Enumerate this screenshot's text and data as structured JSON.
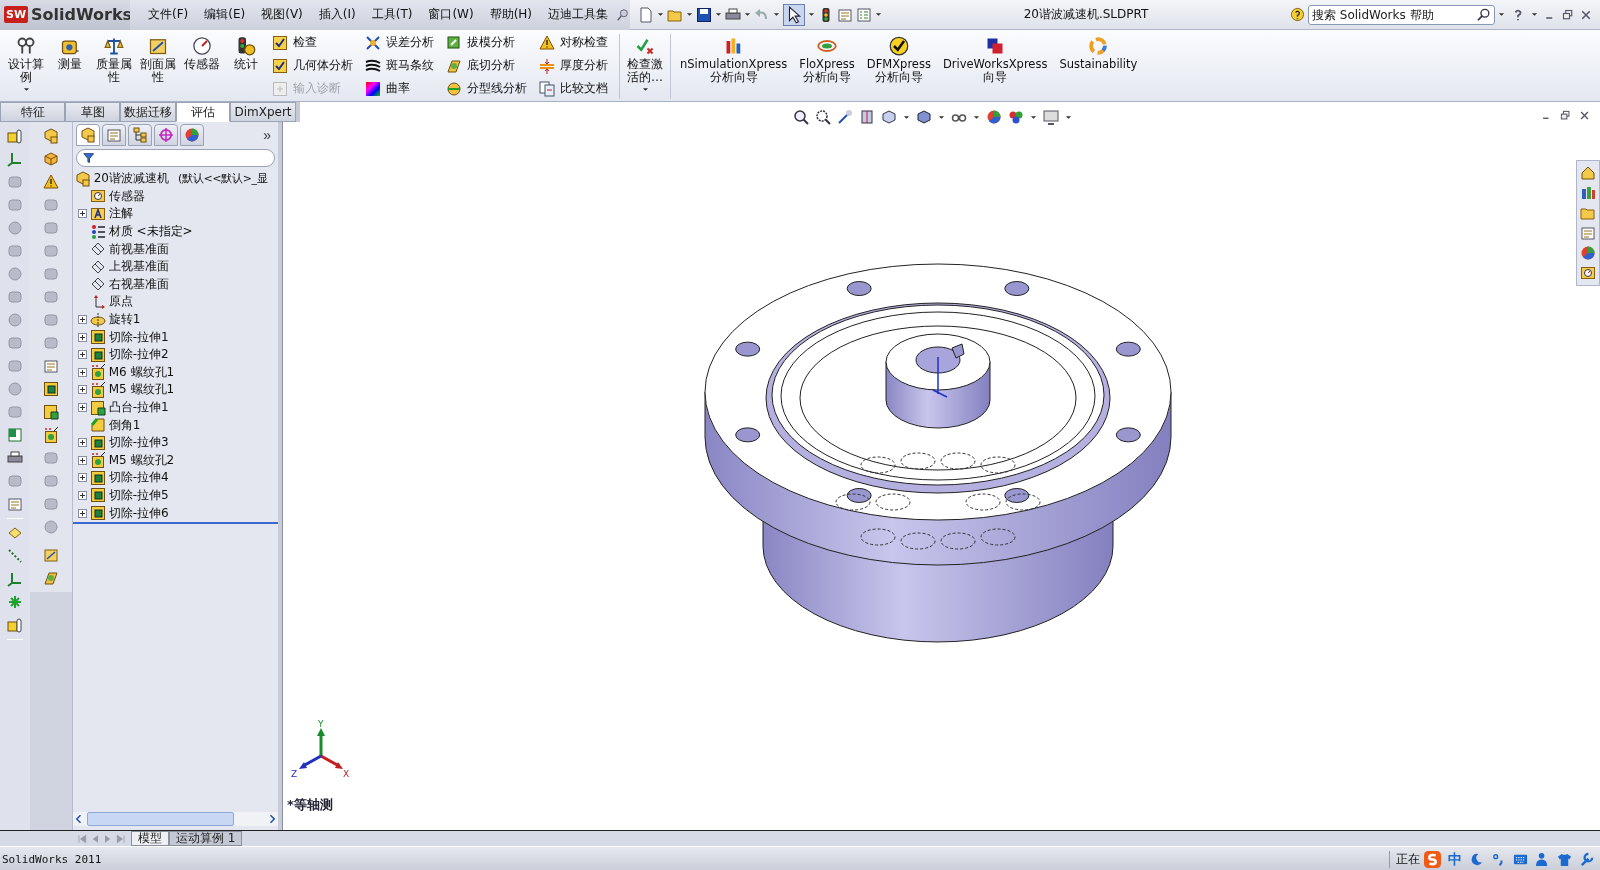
{
  "app": {
    "badge": "SW",
    "logo": "SolidWorks"
  },
  "menu": [
    {
      "label": "文件(F)"
    },
    {
      "label": "编辑(E)"
    },
    {
      "label": "视图(V)"
    },
    {
      "label": "插入(I)"
    },
    {
      "label": "工具(T)"
    },
    {
      "label": "窗口(W)"
    },
    {
      "label": "帮助(H)"
    },
    {
      "label": "迈迪工具集"
    }
  ],
  "title": "20谐波减速机.SLDPRT",
  "search": {
    "placeholder": "搜索 SolidWorks 帮助"
  },
  "ribbon": [
    {
      "kind": "large",
      "label": "设计算例",
      "dropdown": true
    },
    {
      "kind": "large",
      "label": "测量",
      "dropdown": false
    },
    {
      "kind": "large",
      "label": "质量属性",
      "dropdown": false
    },
    {
      "kind": "large",
      "label": "剖面属性",
      "dropdown": false
    },
    {
      "kind": "large",
      "label": "传感器",
      "dropdown": false
    },
    {
      "kind": "large",
      "label": "统计",
      "dropdown": false
    },
    {
      "kind": "column",
      "items": [
        {
          "label": "检查",
          "disabled": false
        },
        {
          "label": "几何体分析",
          "disabled": false
        },
        {
          "label": "输入诊断",
          "disabled": true
        }
      ]
    },
    {
      "kind": "column",
      "items": [
        {
          "label": "误差分析",
          "disabled": false
        },
        {
          "label": "斑马条纹",
          "disabled": false
        },
        {
          "label": "曲率",
          "disabled": false
        }
      ]
    },
    {
      "kind": "column",
      "items": [
        {
          "label": "拔模分析",
          "disabled": false
        },
        {
          "label": "底切分析",
          "disabled": false
        },
        {
          "label": "分型线分析",
          "disabled": false
        }
      ]
    },
    {
      "kind": "column",
      "items": [
        {
          "label": "对称检查",
          "disabled": false
        },
        {
          "label": "厚度分析",
          "disabled": false
        },
        {
          "label": "比较文档",
          "disabled": false
        }
      ]
    },
    {
      "kind": "large",
      "label": "检查激活的…",
      "dropdown": true
    },
    {
      "kind": "xpress",
      "label": "nSimulationXpress 分析向导",
      "dropdown": false
    },
    {
      "kind": "xpress",
      "label": "FloXpress 分析向导",
      "dropdown": false
    },
    {
      "kind": "xpress",
      "label": "DFMXpress 分析向导",
      "dropdown": false
    },
    {
      "kind": "xpress",
      "label": "DriveWorksXpress 向导",
      "dropdown": false
    },
    {
      "kind": "xpress",
      "label": "Sustainability",
      "dropdown": false
    }
  ],
  "command_tabs": [
    {
      "label": "特征",
      "selected": false
    },
    {
      "label": "草图",
      "selected": false
    },
    {
      "label": "数据迁移",
      "selected": false
    },
    {
      "label": "评估",
      "selected": true
    },
    {
      "label": "DimXpert",
      "selected": false
    }
  ],
  "panel": {
    "tabs": [
      {
        "selected": true
      },
      {
        "selected": false
      },
      {
        "selected": false
      },
      {
        "selected": false
      },
      {
        "selected": false
      }
    ],
    "more": "»"
  },
  "tree": {
    "root": {
      "label": "20谐波减速机",
      "config": "(默认<<默认>_显"
    },
    "items": [
      {
        "label": "传感器",
        "kind": "sensor",
        "expandable": false
      },
      {
        "label": "注解",
        "kind": "annotation",
        "expandable": true
      },
      {
        "label": "材质 <未指定>",
        "kind": "material",
        "expandable": false
      },
      {
        "label": "前视基准面",
        "kind": "plane",
        "expandable": false
      },
      {
        "label": "上视基准面",
        "kind": "plane",
        "expandable": false
      },
      {
        "label": "右视基准面",
        "kind": "plane",
        "expandable": false
      },
      {
        "label": "原点",
        "kind": "origin",
        "expandable": false
      },
      {
        "label": "旋转1",
        "kind": "revolve",
        "expandable": true
      },
      {
        "label": "切除-拉伸1",
        "kind": "cut",
        "expandable": true
      },
      {
        "label": "切除-拉伸2",
        "kind": "cut",
        "expandable": true
      },
      {
        "label": "M6 螺纹孔1",
        "kind": "hole",
        "expandable": true
      },
      {
        "label": "M5 螺纹孔1",
        "kind": "hole",
        "expandable": true
      },
      {
        "label": "凸台-拉伸1",
        "kind": "boss",
        "expandable": true
      },
      {
        "label": "倒角1",
        "kind": "chamfer",
        "expandable": false
      },
      {
        "label": "切除-拉伸3",
        "kind": "cut",
        "expandable": true
      },
      {
        "label": "M5 螺纹孔2",
        "kind": "hole",
        "expandable": true
      },
      {
        "label": "切除-拉伸4",
        "kind": "cut",
        "expandable": true
      },
      {
        "label": "切除-拉伸5",
        "kind": "cut",
        "expandable": true
      },
      {
        "label": "切除-拉伸6",
        "kind": "cut",
        "expandable": true
      }
    ]
  },
  "doc_tabs": [
    {
      "label": "模型",
      "selected": true
    },
    {
      "label": "运动算例 1",
      "selected": false
    }
  ],
  "viewport": {
    "view_label": "*等轴测",
    "triad": {
      "x": "X",
      "y": "Y",
      "z": "Z"
    }
  },
  "status": {
    "left": "SolidWorks 2011",
    "right": "正在",
    "ime": "中"
  }
}
